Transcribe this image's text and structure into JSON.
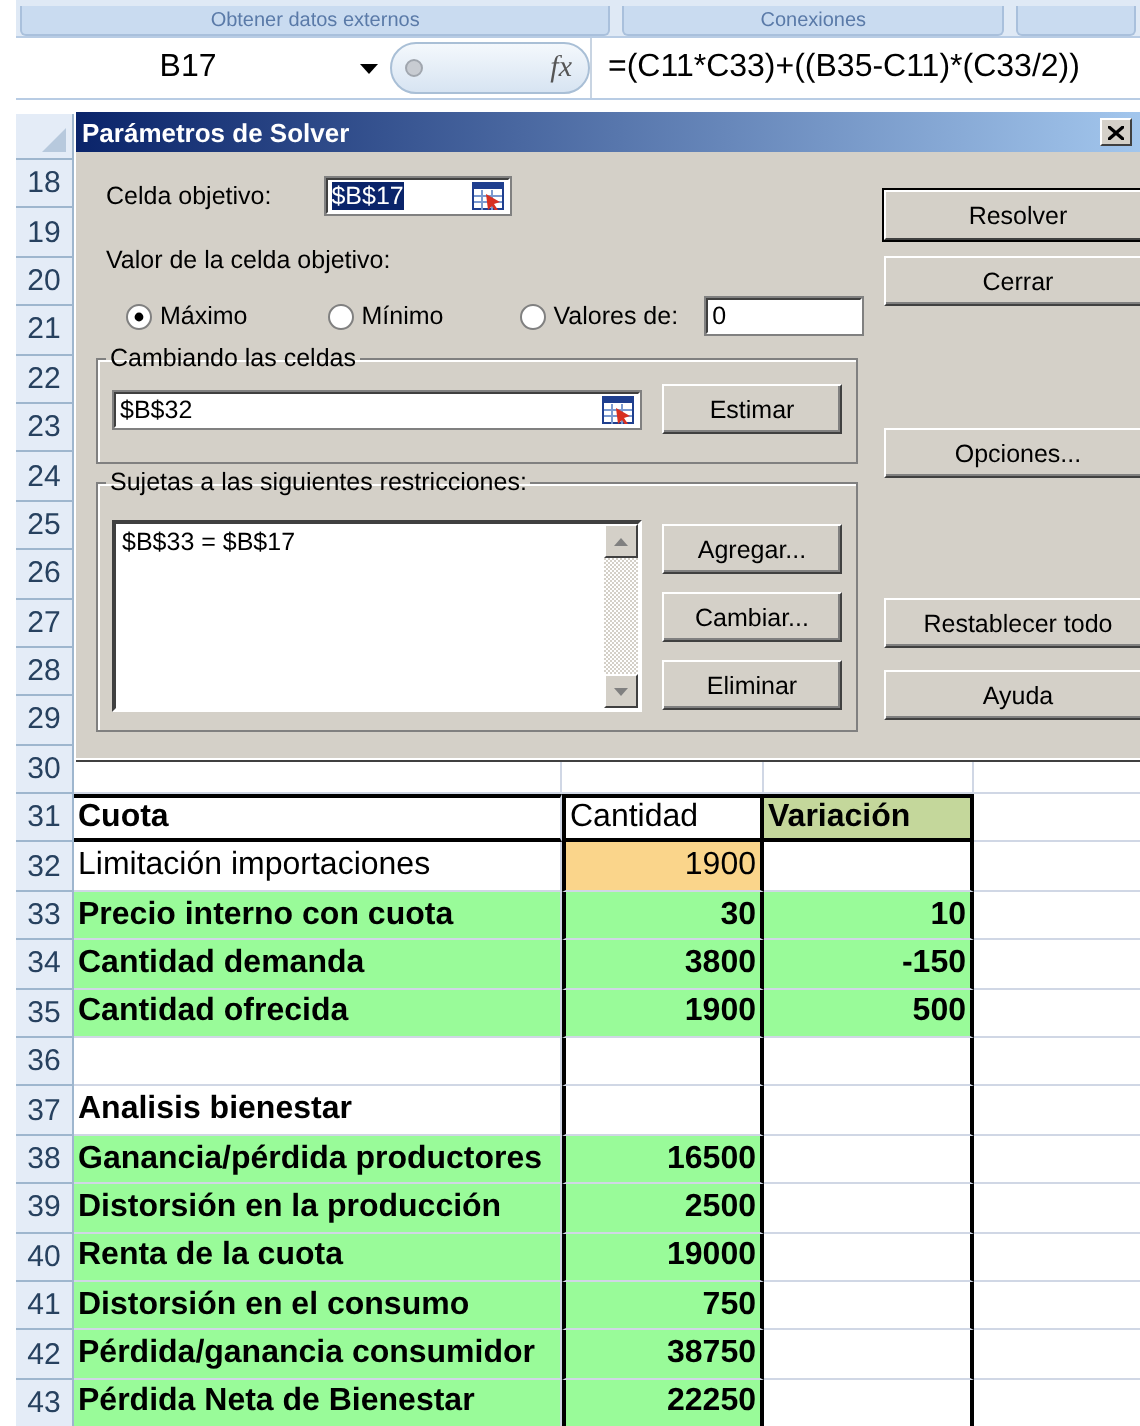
{
  "ribbon": {
    "groups": [
      "Obtener datos externos",
      "Conexiones"
    ]
  },
  "formula_bar": {
    "name_box": "B17",
    "function_label": "fx",
    "formula": "=(C11*C33)+((B35-C11)*(C33/2))"
  },
  "sheet": {
    "blank_rows": [
      "18",
      "19",
      "20",
      "21",
      "22",
      "23",
      "24",
      "25",
      "26",
      "27",
      "28",
      "29",
      "30"
    ],
    "rows": [
      {
        "row": "31",
        "kind": "header",
        "cells": [
          {
            "text": "Cuota",
            "bold": true
          },
          {
            "text": "Cantidad",
            "bold": false
          },
          {
            "text": "Variación",
            "bold": true,
            "color": "#c4d79b"
          }
        ]
      },
      {
        "row": "32",
        "kind": "data",
        "cells": [
          {
            "text": "Limitación importaciones",
            "bold": false
          },
          {
            "text": "1900",
            "bold": false,
            "color": "#fad58b"
          },
          null
        ]
      },
      {
        "row": "33",
        "kind": "data",
        "cells": [
          {
            "text": "Precio interno con cuota",
            "bold": true,
            "color": "#99fb99"
          },
          {
            "text": "30",
            "bold": true,
            "color": "#99fb99"
          },
          {
            "text": "10",
            "bold": true,
            "color": "#99fb99"
          }
        ]
      },
      {
        "row": "34",
        "kind": "data",
        "cells": [
          {
            "text": "Cantidad demanda",
            "bold": true,
            "color": "#99fb99"
          },
          {
            "text": "3800",
            "bold": true,
            "color": "#99fb99"
          },
          {
            "text": "-150",
            "bold": true,
            "color": "#99fb99"
          }
        ]
      },
      {
        "row": "35",
        "kind": "data",
        "cells": [
          {
            "text": "Cantidad ofrecida",
            "bold": true,
            "color": "#99fb99"
          },
          {
            "text": "1900",
            "bold": true,
            "color": "#99fb99"
          },
          {
            "text": "500",
            "bold": true,
            "color": "#99fb99"
          }
        ]
      },
      {
        "row": "36",
        "kind": "data",
        "cells": [
          null,
          null,
          null
        ]
      },
      {
        "row": "37",
        "kind": "data",
        "cells": [
          {
            "text": "Analisis bienestar",
            "bold": true
          },
          null,
          null
        ]
      },
      {
        "row": "38",
        "kind": "data",
        "cells": [
          {
            "text": "Ganancia/pérdida productores",
            "bold": true,
            "color": "#99fb99"
          },
          {
            "text": "16500",
            "bold": true,
            "color": "#99fb99"
          },
          null
        ]
      },
      {
        "row": "39",
        "kind": "data",
        "cells": [
          {
            "text": "Distorsión en la producción",
            "bold": true,
            "color": "#99fb99"
          },
          {
            "text": "2500",
            "bold": true,
            "color": "#99fb99"
          },
          null
        ]
      },
      {
        "row": "40",
        "kind": "data",
        "cells": [
          {
            "text": "Renta de la cuota",
            "bold": true,
            "color": "#99fb99"
          },
          {
            "text": "19000",
            "bold": true,
            "color": "#99fb99"
          },
          null
        ]
      },
      {
        "row": "41",
        "kind": "data",
        "cells": [
          {
            "text": "Distorsión en el consumo",
            "bold": true,
            "color": "#99fb99"
          },
          {
            "text": "750",
            "bold": true,
            "color": "#99fb99"
          },
          null
        ]
      },
      {
        "row": "42",
        "kind": "data",
        "cells": [
          {
            "text": "Pérdida/ganancia consumidor",
            "bold": true,
            "color": "#99fb99"
          },
          {
            "text": "38750",
            "bold": true,
            "color": "#99fb99"
          },
          null
        ]
      },
      {
        "row": "43",
        "kind": "data",
        "cells": [
          {
            "text": "Pérdida Neta de Bienestar",
            "bold": true,
            "color": "#99fb99"
          },
          {
            "text": "22250",
            "bold": true,
            "color": "#99fb99"
          },
          null
        ]
      }
    ]
  },
  "dialog": {
    "title": "Parámetros de Solver",
    "target_label": "Celda objetivo:",
    "target_value": "$B$17",
    "value_label": "Valor de la celda objetivo:",
    "options": [
      {
        "label": "Máximo",
        "selected": true
      },
      {
        "label": "Mínimo",
        "selected": false
      },
      {
        "label": "Valores de:",
        "selected": false
      }
    ],
    "value_of": "0",
    "changing": {
      "legend": "Cambiando las celdas",
      "value": "$B$32",
      "button": "Estimar"
    },
    "constraints": {
      "legend": "Sujetas a las siguientes restricciones:",
      "items": [
        "$B$33 = $B$17"
      ],
      "buttons": [
        "Agregar...",
        "Cambiar...",
        "Eliminar"
      ]
    },
    "side_buttons": [
      {
        "label": "Resolver",
        "default": true
      },
      {
        "label": "Cerrar",
        "default": false
      },
      {
        "label": "Opciones...",
        "default": false
      },
      {
        "label": "Restablecer todo",
        "default": false
      },
      {
        "label": "Ayuda",
        "default": false
      }
    ]
  }
}
